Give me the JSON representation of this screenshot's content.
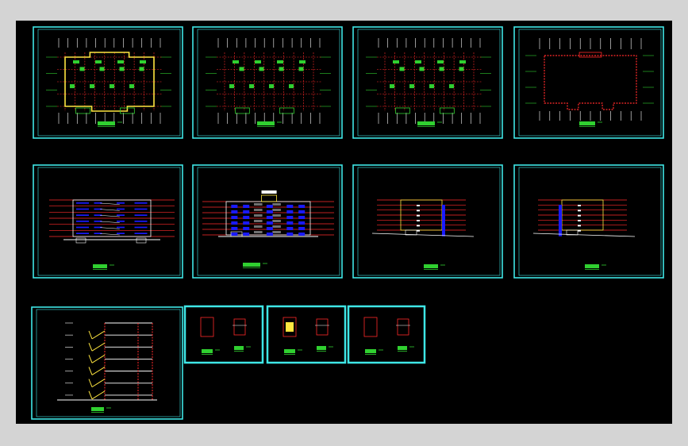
{
  "colors": {
    "background": "#000000",
    "outer_background": "#d4d4d4",
    "frame": "#3ee6e6",
    "grid": "#ffffff",
    "axis": "#ff2a2a",
    "wall": "#ffe640",
    "room": "#30d030",
    "window": "#1a1aff",
    "label": "#30d030"
  },
  "sheets": [
    {
      "id": "floor-plan-1",
      "type": "plan-ground"
    },
    {
      "id": "floor-plan-2",
      "type": "plan-standard"
    },
    {
      "id": "floor-plan-3",
      "type": "plan-standard"
    },
    {
      "id": "roof-plan",
      "type": "plan-roof"
    },
    {
      "id": "front-elevation",
      "type": "elevation-front"
    },
    {
      "id": "rear-elevation",
      "type": "elevation-rear"
    },
    {
      "id": "side-elevation-1",
      "type": "elevation-side"
    },
    {
      "id": "side-elevation-2",
      "type": "elevation-side"
    },
    {
      "id": "section",
      "type": "section"
    },
    {
      "id": "detail-1",
      "type": "detail"
    },
    {
      "id": "detail-2",
      "type": "detail"
    },
    {
      "id": "detail-3",
      "type": "detail"
    }
  ]
}
